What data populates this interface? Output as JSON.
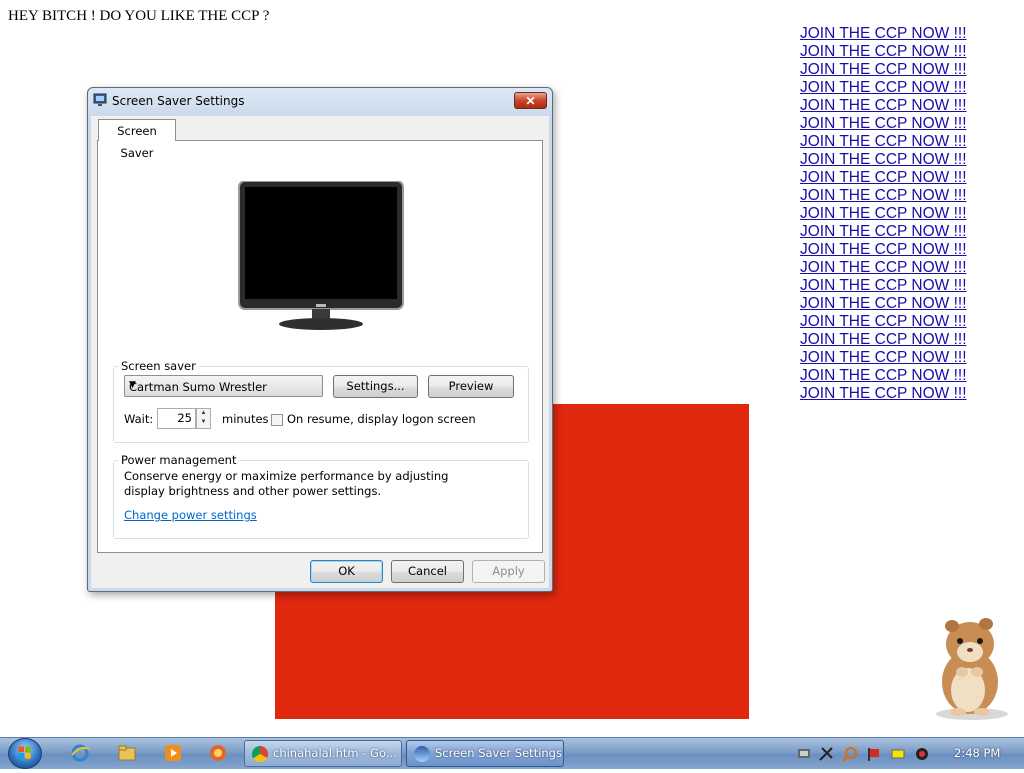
{
  "page": {
    "heading": "HEY BITCH ! DO YOU LIKE THE CCP ?",
    "links": [
      "JOIN THE CCP NOW !!!",
      "JOIN THE CCP NOW !!!",
      "JOIN THE CCP NOW !!!",
      "JOIN THE CCP NOW !!!",
      "JOIN THE CCP NOW !!!",
      "JOIN THE CCP NOW !!!",
      "JOIN THE CCP NOW !!!",
      "JOIN THE CCP NOW !!!",
      "JOIN THE CCP NOW !!!",
      "JOIN THE CCP NOW !!!",
      "JOIN THE CCP NOW !!!",
      "JOIN THE CCP NOW !!!",
      "JOIN THE CCP NOW !!!",
      "JOIN THE CCP NOW !!!",
      "JOIN THE CCP NOW !!!",
      "JOIN THE CCP NOW !!!",
      "JOIN THE CCP NOW !!!",
      "JOIN THE CCP NOW !!!",
      "JOIN THE CCP NOW !!!",
      "JOIN THE CCP NOW !!!",
      "JOIN THE CCP NOW !!!"
    ],
    "colors": {
      "link": "#1a0dab",
      "red_block": "#e0280f"
    }
  },
  "dialog": {
    "title": "Screen Saver Settings",
    "close_label": "✕",
    "tab_label": "Screen Saver",
    "screen_saver_group": {
      "legend": "Screen saver",
      "selected": "Cartman Sumo Wrestler",
      "settings_label": "Settings...",
      "preview_label": "Preview",
      "wait_label": "Wait:",
      "wait_value": "25",
      "minutes_label": "minutes",
      "resume_label": "On resume, display logon screen",
      "resume_checked": false
    },
    "power_group": {
      "legend": "Power management",
      "description": "Conserve energy or maximize performance by adjusting display brightness and other power settings.",
      "link": "Change power settings"
    },
    "ok_label": "OK",
    "cancel_label": "Cancel",
    "apply_label": "Apply"
  },
  "taskbar": {
    "quick_launch": [
      "ie-icon",
      "folder-icon",
      "media-player-icon",
      "app-icon"
    ],
    "tasks": [
      {
        "label": "chinahalal.htm - Go...",
        "icon": "chrome-icon",
        "active": false
      },
      {
        "label": "Screen Saver Settings",
        "icon": "screensaver-icon",
        "active": true
      }
    ],
    "clock": "2:48 PM"
  }
}
